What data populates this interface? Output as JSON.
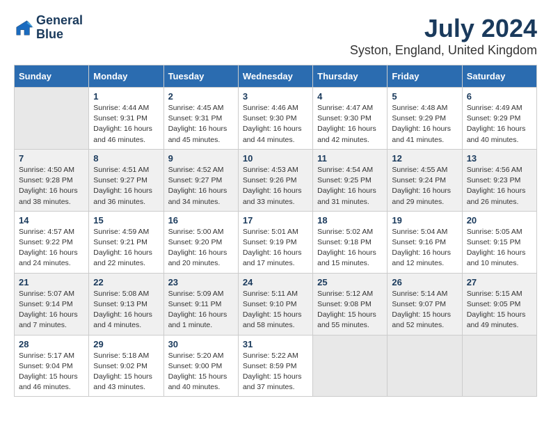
{
  "logo": {
    "line1": "General",
    "line2": "Blue"
  },
  "title": "July 2024",
  "location": "Syston, England, United Kingdom",
  "days_of_week": [
    "Sunday",
    "Monday",
    "Tuesday",
    "Wednesday",
    "Thursday",
    "Friday",
    "Saturday"
  ],
  "weeks": [
    [
      {
        "num": "",
        "info": ""
      },
      {
        "num": "1",
        "info": "Sunrise: 4:44 AM\nSunset: 9:31 PM\nDaylight: 16 hours\nand 46 minutes."
      },
      {
        "num": "2",
        "info": "Sunrise: 4:45 AM\nSunset: 9:31 PM\nDaylight: 16 hours\nand 45 minutes."
      },
      {
        "num": "3",
        "info": "Sunrise: 4:46 AM\nSunset: 9:30 PM\nDaylight: 16 hours\nand 44 minutes."
      },
      {
        "num": "4",
        "info": "Sunrise: 4:47 AM\nSunset: 9:30 PM\nDaylight: 16 hours\nand 42 minutes."
      },
      {
        "num": "5",
        "info": "Sunrise: 4:48 AM\nSunset: 9:29 PM\nDaylight: 16 hours\nand 41 minutes."
      },
      {
        "num": "6",
        "info": "Sunrise: 4:49 AM\nSunset: 9:29 PM\nDaylight: 16 hours\nand 40 minutes."
      }
    ],
    [
      {
        "num": "7",
        "info": "Sunrise: 4:50 AM\nSunset: 9:28 PM\nDaylight: 16 hours\nand 38 minutes."
      },
      {
        "num": "8",
        "info": "Sunrise: 4:51 AM\nSunset: 9:27 PM\nDaylight: 16 hours\nand 36 minutes."
      },
      {
        "num": "9",
        "info": "Sunrise: 4:52 AM\nSunset: 9:27 PM\nDaylight: 16 hours\nand 34 minutes."
      },
      {
        "num": "10",
        "info": "Sunrise: 4:53 AM\nSunset: 9:26 PM\nDaylight: 16 hours\nand 33 minutes."
      },
      {
        "num": "11",
        "info": "Sunrise: 4:54 AM\nSunset: 9:25 PM\nDaylight: 16 hours\nand 31 minutes."
      },
      {
        "num": "12",
        "info": "Sunrise: 4:55 AM\nSunset: 9:24 PM\nDaylight: 16 hours\nand 29 minutes."
      },
      {
        "num": "13",
        "info": "Sunrise: 4:56 AM\nSunset: 9:23 PM\nDaylight: 16 hours\nand 26 minutes."
      }
    ],
    [
      {
        "num": "14",
        "info": "Sunrise: 4:57 AM\nSunset: 9:22 PM\nDaylight: 16 hours\nand 24 minutes."
      },
      {
        "num": "15",
        "info": "Sunrise: 4:59 AM\nSunset: 9:21 PM\nDaylight: 16 hours\nand 22 minutes."
      },
      {
        "num": "16",
        "info": "Sunrise: 5:00 AM\nSunset: 9:20 PM\nDaylight: 16 hours\nand 20 minutes."
      },
      {
        "num": "17",
        "info": "Sunrise: 5:01 AM\nSunset: 9:19 PM\nDaylight: 16 hours\nand 17 minutes."
      },
      {
        "num": "18",
        "info": "Sunrise: 5:02 AM\nSunset: 9:18 PM\nDaylight: 16 hours\nand 15 minutes."
      },
      {
        "num": "19",
        "info": "Sunrise: 5:04 AM\nSunset: 9:16 PM\nDaylight: 16 hours\nand 12 minutes."
      },
      {
        "num": "20",
        "info": "Sunrise: 5:05 AM\nSunset: 9:15 PM\nDaylight: 16 hours\nand 10 minutes."
      }
    ],
    [
      {
        "num": "21",
        "info": "Sunrise: 5:07 AM\nSunset: 9:14 PM\nDaylight: 16 hours\nand 7 minutes."
      },
      {
        "num": "22",
        "info": "Sunrise: 5:08 AM\nSunset: 9:13 PM\nDaylight: 16 hours\nand 4 minutes."
      },
      {
        "num": "23",
        "info": "Sunrise: 5:09 AM\nSunset: 9:11 PM\nDaylight: 16 hours\nand 1 minute."
      },
      {
        "num": "24",
        "info": "Sunrise: 5:11 AM\nSunset: 9:10 PM\nDaylight: 15 hours\nand 58 minutes."
      },
      {
        "num": "25",
        "info": "Sunrise: 5:12 AM\nSunset: 9:08 PM\nDaylight: 15 hours\nand 55 minutes."
      },
      {
        "num": "26",
        "info": "Sunrise: 5:14 AM\nSunset: 9:07 PM\nDaylight: 15 hours\nand 52 minutes."
      },
      {
        "num": "27",
        "info": "Sunrise: 5:15 AM\nSunset: 9:05 PM\nDaylight: 15 hours\nand 49 minutes."
      }
    ],
    [
      {
        "num": "28",
        "info": "Sunrise: 5:17 AM\nSunset: 9:04 PM\nDaylight: 15 hours\nand 46 minutes."
      },
      {
        "num": "29",
        "info": "Sunrise: 5:18 AM\nSunset: 9:02 PM\nDaylight: 15 hours\nand 43 minutes."
      },
      {
        "num": "30",
        "info": "Sunrise: 5:20 AM\nSunset: 9:00 PM\nDaylight: 15 hours\nand 40 minutes."
      },
      {
        "num": "31",
        "info": "Sunrise: 5:22 AM\nSunset: 8:59 PM\nDaylight: 15 hours\nand 37 minutes."
      },
      {
        "num": "",
        "info": ""
      },
      {
        "num": "",
        "info": ""
      },
      {
        "num": "",
        "info": ""
      }
    ]
  ]
}
